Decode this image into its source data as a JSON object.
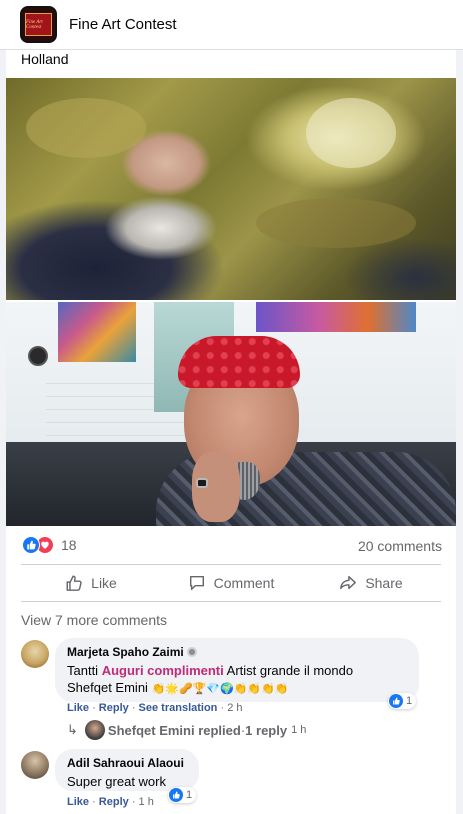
{
  "header": {
    "title": "Fine Art Contest",
    "avatar_text": "Fine Art Contest"
  },
  "post": {
    "text": "Holland",
    "reaction_count": "18",
    "comments_count": "20 comments"
  },
  "actions": {
    "like": "Like",
    "comment": "Comment",
    "share": "Share"
  },
  "comments": {
    "view_more": "View 7 more comments",
    "c1": {
      "author": "Marjeta Spaho Zaimi",
      "text_a": "Tantti ",
      "text_highlight": "Auguri complimenti",
      "text_b": " Artist grande il mondo",
      "text_line2": "Shefqet Emini ",
      "emojis": "👏🌟🥜🏆💎🌍👏👏👏👏",
      "like": "Like",
      "reply": "Reply",
      "translate": "See translation",
      "time": "2 h",
      "reaction_count": "1"
    },
    "reply_summary": {
      "name": "Shefqet Emini replied",
      "sep": " · ",
      "count": "1 reply",
      "time": "1 h"
    },
    "c2": {
      "author": "Adil Sahraoui Alaoui",
      "text": "Super great work",
      "like": "Like",
      "reply": "Reply",
      "time": "1 h",
      "reaction_count": "1"
    }
  }
}
